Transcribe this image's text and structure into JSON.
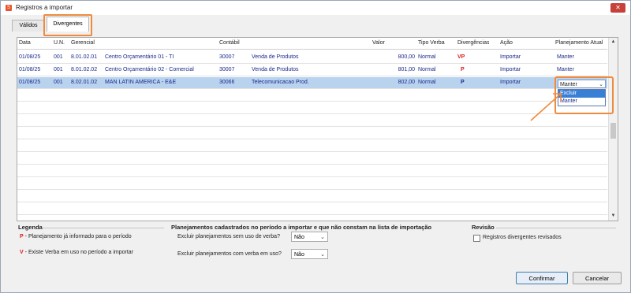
{
  "window": {
    "title": "Registros a importar",
    "close_label": "✕",
    "app_icon_label": "S"
  },
  "tabs": [
    {
      "label": "Válidos",
      "active": false
    },
    {
      "label": "Divergentes",
      "active": true
    }
  ],
  "grid": {
    "columns": [
      "Data",
      "U.N.",
      "Gerencial",
      "Contábil",
      "Valor",
      "Tipo Verba",
      "Divergências",
      "Ação",
      "Planejamento Atual"
    ],
    "rows": [
      {
        "data": "01/08/25",
        "un": "001",
        "ger_code": "8.01.02.01",
        "ger_name": "Centro Orçamentário 01 - TI",
        "cont_code": "30007",
        "cont_name": "Venda de Produtos",
        "valor": "800,00",
        "tipo": "Normal",
        "div": "VP",
        "acao": "Importar",
        "plan": "Manter"
      },
      {
        "data": "01/08/25",
        "un": "001",
        "ger_code": "8.01.02.02",
        "ger_name": "Centro Orçamentário 02 - Comercial",
        "cont_code": "30007",
        "cont_name": "Venda de Produtos",
        "valor": "801,00",
        "tipo": "Normal",
        "div": "P",
        "acao": "Importar",
        "plan": "Manter"
      },
      {
        "data": "01/08/25",
        "un": "001",
        "ger_code": "8.02.01.02",
        "ger_name": "MAN LATIN AMERICA - E&E",
        "cont_code": "30066",
        "cont_name": "Telecomunicacao Prod.",
        "valor": "802,00",
        "tipo": "Normal",
        "div": "P",
        "acao": "Importar",
        "plan": "Manter"
      }
    ],
    "combo_value": "Manter",
    "dropdown_options": [
      "Excluir",
      "Manter"
    ],
    "highlighted_option": "Excluir",
    "selected_row": 2
  },
  "legend": {
    "title": "Legenda",
    "items": [
      {
        "code": "P",
        "text": "- Planejamento já informado para o período"
      },
      {
        "code": "V",
        "text": "- Existe Verba em uso no período a importar"
      }
    ]
  },
  "planning": {
    "title": "Planejamentos cadastrados no período a importar e que não constam na lista de importação",
    "fields": [
      {
        "label": "Excluir planejamentos sem uso de verba?",
        "value": "Não"
      },
      {
        "label": "Excluir planejamentos com verba em uso?",
        "value": "Não"
      }
    ]
  },
  "review": {
    "title": "Revisão",
    "checkbox_label": "Registros divergentes revisados",
    "checked": false
  },
  "buttons": {
    "confirm": "Confirmar",
    "cancel": "Cancelar"
  },
  "colors": {
    "highlight": "#f08a3c",
    "selection": "#b9d3ef",
    "red_code": "#d91b1b",
    "blue_text": "#1a2a8a"
  }
}
